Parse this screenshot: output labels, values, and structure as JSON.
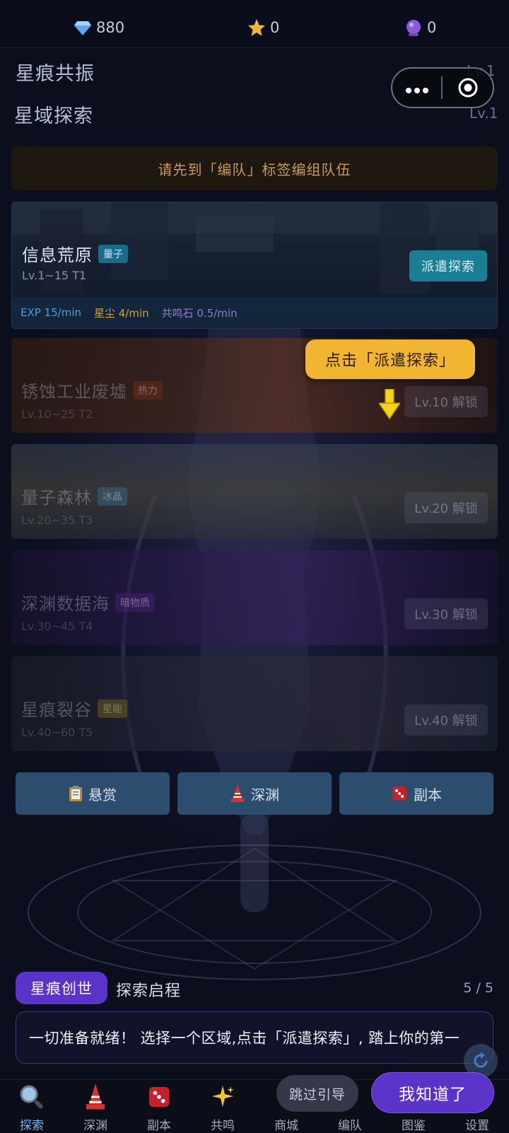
{
  "currency": {
    "diamonds": "880",
    "stars": "0",
    "orbs": "0"
  },
  "sections": {
    "resonance": {
      "title": "星痕共振",
      "level": "Lv.1"
    },
    "exploration": {
      "title": "星域探索",
      "level": "Lv.1"
    }
  },
  "notice": "请先到「编队」标签编组队伍",
  "zones": [
    {
      "name": "信息荒原",
      "tag": "量子",
      "levels": "Lv.1~15  T1",
      "action": "派遣探索",
      "rates": {
        "exp": "EXP 15/min",
        "dust": "星尘 4/min",
        "stone": "共鸣石 0.5/min"
      }
    },
    {
      "name": "锈蚀工业废墟",
      "tag": "热力",
      "levels": "Lv.10~25  T2",
      "action": "Lv.10 解锁"
    },
    {
      "name": "量子森林",
      "tag": "冰晶",
      "levels": "Lv.20~35  T3",
      "action": "Lv.20 解锁"
    },
    {
      "name": "深渊数据海",
      "tag": "暗物质",
      "levels": "Lv.30~45  T4",
      "action": "Lv.30 解锁"
    },
    {
      "name": "星痕裂谷",
      "tag": "星能",
      "levels": "Lv.40~60  T5",
      "action": "Lv.40 解锁"
    }
  ],
  "tooltip": "点击「派遣探索」",
  "quick_actions": [
    {
      "label": "悬赏",
      "icon": "clipboard-icon"
    },
    {
      "label": "深渊",
      "icon": "tower-icon"
    },
    {
      "label": "副本",
      "icon": "dice-icon"
    }
  ],
  "guide": {
    "badge": "星痕创世",
    "title": "探索启程",
    "page": "5 / 5",
    "text": "一切准备就绪！ 选择一个区域,点击「派遣探索」, 踏上你的第一",
    "skip": "跳过引导",
    "confirm": "我知道了"
  },
  "tabs": [
    {
      "label": "探索",
      "icon": "magnifier-icon",
      "active": true
    },
    {
      "label": "深渊",
      "icon": "tower-icon"
    },
    {
      "label": "副本",
      "icon": "dice-icon"
    },
    {
      "label": "共鸣",
      "icon": "sparkles-icon"
    },
    {
      "label": "商城",
      "icon": "shop-icon"
    },
    {
      "label": "编队",
      "icon": "team-icon"
    },
    {
      "label": "图鉴",
      "icon": "book-icon"
    },
    {
      "label": "设置",
      "icon": "gear-icon"
    }
  ],
  "colors": {
    "accent_purple": "#5a34c8",
    "dispatch_teal": "#1a7e95",
    "tooltip_gold": "#f2b531",
    "tab_active": "#6fb7ff",
    "tag_quantum": "#1c6a8e",
    "tag_thermal": "#7a2e16",
    "tag_ice": "#3a6f93",
    "tag_dark": "#4e1f79",
    "tag_star": "#7a6a18"
  }
}
